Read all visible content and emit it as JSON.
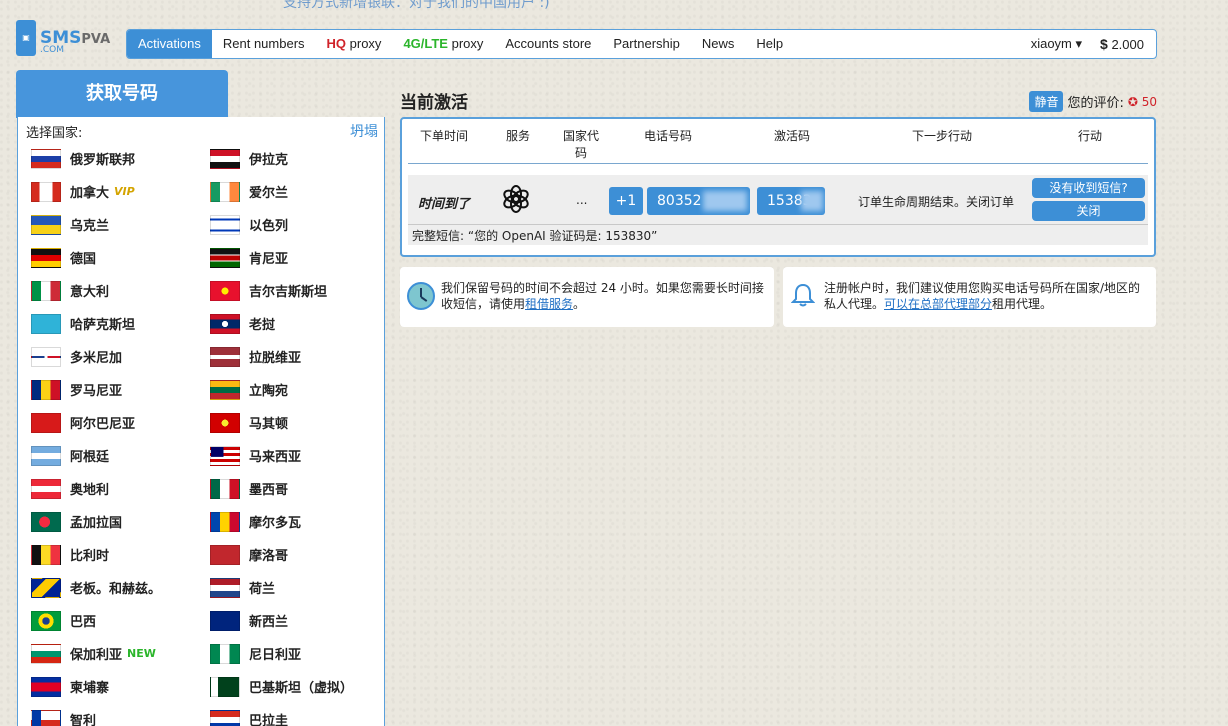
{
  "banner": {
    "text": "支持方式新增银联：对于我们的中国用户 :)"
  },
  "logo": {
    "main": "SMS",
    "pva": "PVA",
    "sub": ".COM"
  },
  "nav": {
    "items": [
      {
        "label": "Activations"
      },
      {
        "label": "Rent numbers"
      },
      {
        "prefix": "HQ",
        "label": " proxy"
      },
      {
        "prefix": "4G/LTE",
        "label": " proxy"
      },
      {
        "label": "Accounts store"
      },
      {
        "label": "Partnership"
      },
      {
        "label": "News"
      },
      {
        "label": "Help"
      }
    ],
    "user": "xiaoym ▾",
    "balance_symbol": "$",
    "balance": "2.000"
  },
  "sidebar": {
    "tab_label": "获取号码",
    "select_label": "选择国家:",
    "collapse_label": "坍塌",
    "countries_left": [
      {
        "name": "俄罗斯联邦",
        "flag": "russia"
      },
      {
        "name": "加拿大",
        "flag": "canada",
        "badge": "VIP"
      },
      {
        "name": "乌克兰",
        "flag": "ukraine"
      },
      {
        "name": "德国",
        "flag": "germany"
      },
      {
        "name": "意大利",
        "flag": "italy"
      },
      {
        "name": "哈萨克斯坦",
        "flag": "kazakhstan"
      },
      {
        "name": "多米尼加",
        "flag": "dominican"
      },
      {
        "name": "罗马尼亚",
        "flag": "romania"
      },
      {
        "name": "阿尔巴尼亚",
        "flag": "albania"
      },
      {
        "name": "阿根廷",
        "flag": "argentina"
      },
      {
        "name": "奥地利",
        "flag": "austria"
      },
      {
        "name": "孟加拉国",
        "flag": "bangladesh"
      },
      {
        "name": "比利时",
        "flag": "belgium"
      },
      {
        "name": "老板。和赫兹。",
        "flag": "bosnia"
      },
      {
        "name": "巴西",
        "flag": "brazil"
      },
      {
        "name": "保加利亚",
        "flag": "bulgaria",
        "badge_new": "NEW"
      },
      {
        "name": "柬埔寨",
        "flag": "cambodia"
      },
      {
        "name": "智利",
        "flag": "chile"
      }
    ],
    "countries_right": [
      {
        "name": "伊拉克",
        "flag": "iraq"
      },
      {
        "name": "爱尔兰",
        "flag": "ireland"
      },
      {
        "name": "以色列",
        "flag": "israel"
      },
      {
        "name": "肯尼亚",
        "flag": "kenya"
      },
      {
        "name": "吉尔吉斯斯坦",
        "flag": "kyrgyzstan"
      },
      {
        "name": "老挝",
        "flag": "laos"
      },
      {
        "name": "拉脱维亚",
        "flag": "latvia"
      },
      {
        "name": "立陶宛",
        "flag": "lithuania"
      },
      {
        "name": "马其顿",
        "flag": "macedonia"
      },
      {
        "name": "马来西亚",
        "flag": "malaysia"
      },
      {
        "name": "墨西哥",
        "flag": "mexico"
      },
      {
        "name": "摩尔多瓦",
        "flag": "moldova"
      },
      {
        "name": "摩洛哥",
        "flag": "morocco"
      },
      {
        "name": "荷兰",
        "flag": "netherlands"
      },
      {
        "name": "新西兰",
        "flag": "newzealand"
      },
      {
        "name": "尼日利亚",
        "flag": "nigeria"
      },
      {
        "name": "巴基斯坦（虚拟）",
        "flag": "pakistan"
      },
      {
        "name": "巴拉圭",
        "flag": "paraguay"
      }
    ]
  },
  "activations": {
    "title": "当前激活",
    "mute_label": "静音",
    "rating_label": "您的评价:",
    "rating_value": "✪ 50",
    "columns": [
      "下单时间",
      "服务",
      "国家代码",
      "电话号码",
      "激活码",
      "下一步行动",
      "行动"
    ],
    "row": {
      "time": "时间到了",
      "service_icon": "openai-icon",
      "dots": "...",
      "country_code": "+1",
      "phone": "80352",
      "sms_code": "15383",
      "next_step": "订单生命周期结束。关闭订单",
      "btn_no_sms": "没有收到短信?",
      "btn_close": "关闭",
      "full_sms": "完整短信: “您的 OpenAI 验证码是: 153830”"
    }
  },
  "info": {
    "left_text_1": "我们保留号码的时间不会超过 24 小时。如果您需要长时间接收短信，请使用",
    "left_link": "租借服务",
    "left_text_2": "。",
    "right_text_1": "注册帐户时，我们建议使用您购买电话号码所在国家/地区的私人代理。",
    "right_link": "可以在总部代理部分",
    "right_text_2": "租用代理。"
  },
  "colors": {
    "accent": "#3d8fd6",
    "hq": "#d0232a",
    "lte": "#2bb52b"
  }
}
